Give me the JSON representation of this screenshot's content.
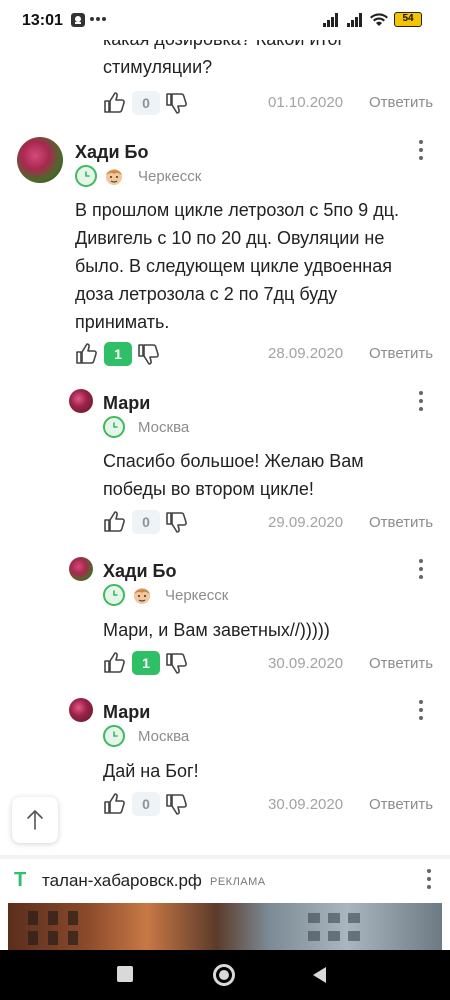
{
  "status_bar": {
    "time": "13:01",
    "battery": "54"
  },
  "comments": [
    {
      "id": "c0",
      "text_lines": [
        "какая дозировка? Какой итог",
        "стимуляции?"
      ],
      "votes": "0",
      "date": "01.10.2020",
      "reply_label": "Ответить"
    },
    {
      "id": "c1",
      "author": "Хади Бо",
      "city": "Черкесск",
      "text_lines": [
        "В прошлом цикле летрозол с 5по 9 дц.",
        "Дивигель с 10 по 20 дц. Овуляции не",
        "было. В следующем цикле удвоенная",
        "доза летрозола с 2 по 7дц буду",
        "принимать."
      ],
      "votes": "1",
      "date": "28.09.2020",
      "reply_label": "Ответить"
    },
    {
      "id": "c2",
      "author": "Мари",
      "city": "Москва",
      "text_lines": [
        "Спасибо большое! Желаю Вам",
        "победы во втором цикле!"
      ],
      "votes": "0",
      "date": "29.09.2020",
      "reply_label": "Ответить"
    },
    {
      "id": "c3",
      "author": "Хади Бо",
      "city": "Черкесск",
      "text_lines": [
        "Мари, и Вам заветных//)))))"
      ],
      "votes": "1",
      "date": "30.09.2020",
      "reply_label": "Ответить"
    },
    {
      "id": "c4",
      "author": "Мари",
      "city": "Москва",
      "text_lines": [
        "Дай на Бог!"
      ],
      "votes": "0",
      "date": "30.09.2020",
      "reply_label": "Ответить"
    }
  ],
  "ad": {
    "logo": "T",
    "domain": "талан-хабаровск.рф",
    "tag": "РЕКЛАМА"
  },
  "icons": {
    "scroll_top": "arrow-up-icon",
    "like": "thumb-up-icon",
    "dislike": "thumb-down-icon",
    "more": "more-vertical-icon"
  },
  "colors": {
    "accent_green": "#2fbf66",
    "muted": "#8c8c8c"
  }
}
